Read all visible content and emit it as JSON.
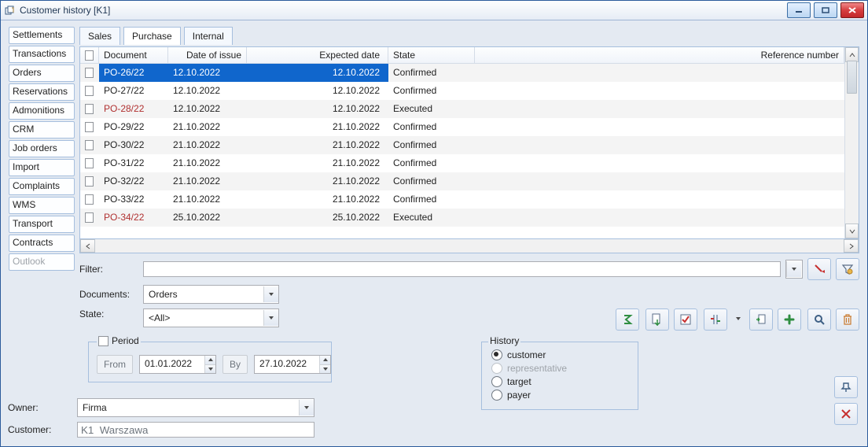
{
  "window": {
    "title": "Customer history [K1]"
  },
  "sidebar": [
    {
      "label": "Settlements"
    },
    {
      "label": "Transactions"
    },
    {
      "label": "Orders"
    },
    {
      "label": "Reservations"
    },
    {
      "label": "Admonitions"
    },
    {
      "label": "CRM"
    },
    {
      "label": "Job orders"
    },
    {
      "label": "Import"
    },
    {
      "label": "Complaints"
    },
    {
      "label": "WMS"
    },
    {
      "label": "Transport"
    },
    {
      "label": "Contracts"
    },
    {
      "label": "Outlook",
      "disabled": true
    }
  ],
  "tabs": [
    {
      "label": "Sales"
    },
    {
      "label": "Purchase",
      "active": true
    },
    {
      "label": "Internal"
    }
  ],
  "grid": {
    "columns": [
      "Document",
      "Date of issue",
      "Expected date",
      "State",
      "Reference number"
    ],
    "rows": [
      {
        "sel": true,
        "d": "PO-26/22",
        "i": "12.10.2022",
        "e": "12.10.2022",
        "s": "Confirmed",
        "r": ""
      },
      {
        "d": "PO-27/22",
        "i": "12.10.2022",
        "e": "12.10.2022",
        "s": "Confirmed",
        "r": ""
      },
      {
        "d": "PO-28/22",
        "i": "12.10.2022",
        "e": "12.10.2022",
        "s": "Executed",
        "r": "",
        "exec": true
      },
      {
        "d": "PO-29/22",
        "i": "21.10.2022",
        "e": "21.10.2022",
        "s": "Confirmed",
        "r": ""
      },
      {
        "d": "PO-30/22",
        "i": "21.10.2022",
        "e": "21.10.2022",
        "s": "Confirmed",
        "r": ""
      },
      {
        "d": "PO-31/22",
        "i": "21.10.2022",
        "e": "21.10.2022",
        "s": "Confirmed",
        "r": ""
      },
      {
        "d": "PO-32/22",
        "i": "21.10.2022",
        "e": "21.10.2022",
        "s": "Confirmed",
        "r": ""
      },
      {
        "d": "PO-33/22",
        "i": "21.10.2022",
        "e": "21.10.2022",
        "s": "Confirmed",
        "r": ""
      },
      {
        "d": "PO-34/22",
        "i": "25.10.2022",
        "e": "25.10.2022",
        "s": "Executed",
        "r": "",
        "exec": true
      }
    ]
  },
  "filter": {
    "label": "Filter:",
    "value": ""
  },
  "documents": {
    "label": "Documents:",
    "value": "Orders"
  },
  "state": {
    "label": "State:",
    "value": "<All>"
  },
  "period": {
    "legend": "Period",
    "from_label": "From",
    "from": "01.01.2022",
    "by_label": "By",
    "to": "27.10.2022"
  },
  "history": {
    "legend": "History",
    "options": [
      {
        "label": "customer",
        "checked": true
      },
      {
        "label": "representative",
        "disabled": true
      },
      {
        "label": "target"
      },
      {
        "label": "payer"
      }
    ]
  },
  "owner": {
    "label": "Owner:",
    "value": "Firma"
  },
  "customer": {
    "label": "Customer:",
    "value": "K1  Warszawa"
  }
}
